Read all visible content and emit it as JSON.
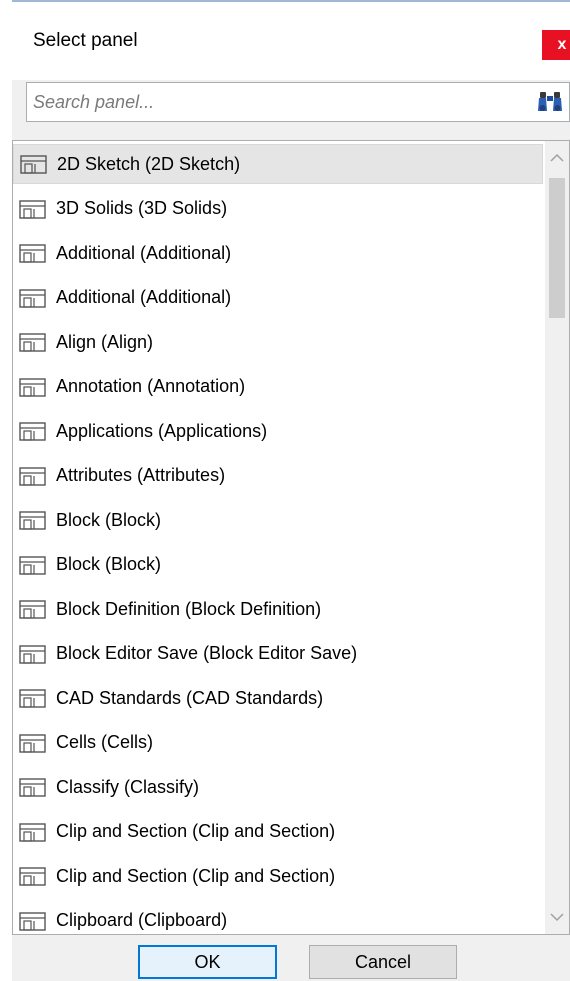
{
  "dialog": {
    "title": "Select panel",
    "close_label": "x"
  },
  "search": {
    "placeholder": "Search panel...",
    "value": ""
  },
  "list": {
    "selected_index": 0,
    "items": [
      {
        "label": "2D Sketch (2D Sketch)"
      },
      {
        "label": "3D Solids (3D Solids)"
      },
      {
        "label": "Additional (Additional)"
      },
      {
        "label": "Additional (Additional)"
      },
      {
        "label": "Align (Align)"
      },
      {
        "label": "Annotation (Annotation)"
      },
      {
        "label": "Applications (Applications)"
      },
      {
        "label": "Attributes (Attributes)"
      },
      {
        "label": "Block (Block)"
      },
      {
        "label": "Block (Block)"
      },
      {
        "label": "Block Definition (Block Definition)"
      },
      {
        "label": "Block Editor Save (Block Editor Save)"
      },
      {
        "label": "CAD Standards (CAD Standards)"
      },
      {
        "label": "Cells (Cells)"
      },
      {
        "label": "Classify (Classify)"
      },
      {
        "label": "Clip and Section (Clip and Section)"
      },
      {
        "label": "Clip and Section (Clip and Section)"
      },
      {
        "label": "Clipboard (Clipboard)"
      }
    ]
  },
  "buttons": {
    "ok_label": "OK",
    "cancel_label": "Cancel"
  },
  "icons": {
    "close": "close-icon",
    "search": "binoculars-icon",
    "item": "panel-icon",
    "scroll_up": "chevron-up-icon",
    "scroll_down": "chevron-down-icon"
  },
  "colors": {
    "close_bg": "#e81123",
    "ok_border": "#0078d7",
    "selected_bg": "#e5e5e5"
  }
}
